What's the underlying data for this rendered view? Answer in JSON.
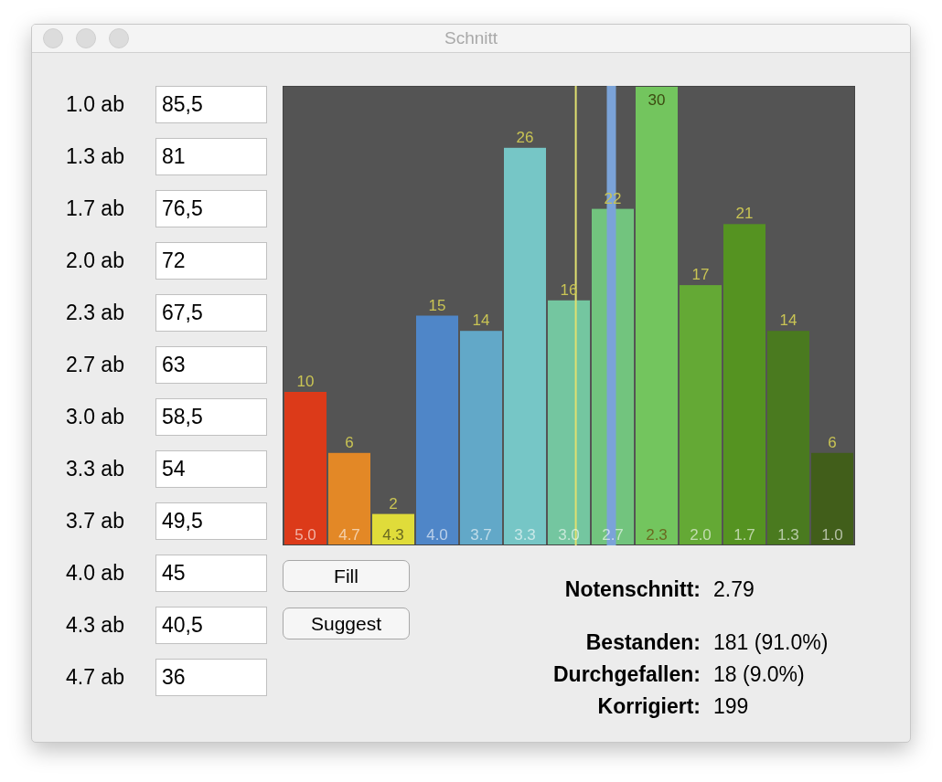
{
  "window": {
    "title": "Schnitt"
  },
  "thresholds": [
    {
      "label": "1.0 ab",
      "value": "85,5"
    },
    {
      "label": "1.3 ab",
      "value": "81"
    },
    {
      "label": "1.7 ab",
      "value": "76,5"
    },
    {
      "label": "2.0 ab",
      "value": "72"
    },
    {
      "label": "2.3 ab",
      "value": "67,5"
    },
    {
      "label": "2.7 ab",
      "value": "63"
    },
    {
      "label": "3.0 ab",
      "value": "58,5"
    },
    {
      "label": "3.3 ab",
      "value": "54"
    },
    {
      "label": "3.7 ab",
      "value": "49,5"
    },
    {
      "label": "4.0 ab",
      "value": "45"
    },
    {
      "label": "4.3 ab",
      "value": "40,5"
    },
    {
      "label": "4.7 ab",
      "value": "36"
    }
  ],
  "histogram": {
    "chart_data": {
      "type": "bar",
      "categories": [
        "5.0",
        "4.7",
        "4.3",
        "4.0",
        "3.7",
        "3.3",
        "3.0",
        "2.7",
        "2.3",
        "2.0",
        "1.7",
        "1.3",
        "1.0"
      ],
      "series": [
        {
          "values": [
            10,
            6,
            2,
            15,
            14,
            26,
            16,
            22,
            30,
            17,
            21,
            14,
            6
          ]
        }
      ],
      "ylim": [
        0,
        30
      ],
      "data_labels": true
    }
  },
  "buttons": [
    "Fill",
    "Suggest"
  ],
  "stats": [
    {
      "label": "Notenschnitt:",
      "value": "2.79"
    },
    {
      "label": "Bestanden:",
      "value": "181 (91.0%)"
    },
    {
      "label": "Durchgefallen:",
      "value": "18 (9.0%)"
    },
    {
      "label": "Korrigiert:",
      "value": "199"
    }
  ]
}
